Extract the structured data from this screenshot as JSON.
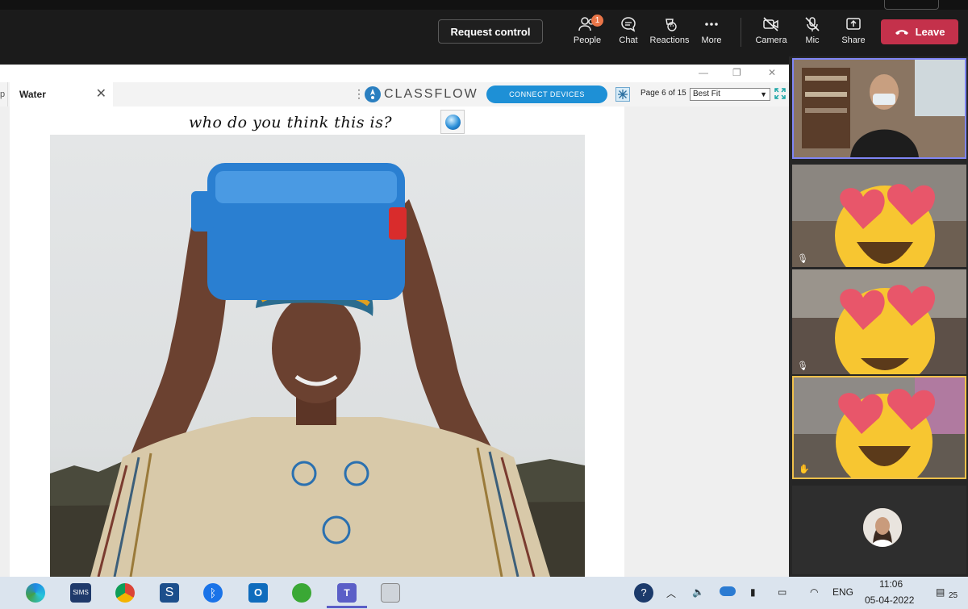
{
  "teams": {
    "request_control": "Request control",
    "people": {
      "label": "People",
      "badge": "1"
    },
    "chat": "Chat",
    "reactions": "Reactions",
    "more": "More",
    "camera": "Camera",
    "mic": "Mic",
    "share": "Share",
    "leave": "Leave",
    "colors": {
      "leave": "#c4314b",
      "badge": "#e97548",
      "active_border": "#7f85f5",
      "hand_border": "#f0c14b"
    }
  },
  "window": {
    "controls": [
      "—",
      "❐",
      "✕"
    ]
  },
  "browser": {
    "left_tab_fragment": "p",
    "tab": "Water",
    "tab_close": "✕",
    "menu": "⋮"
  },
  "classflow": {
    "brand": "CLASSFLOW",
    "connect": "CONNECT DEVICES",
    "page": "Page 6 of 15",
    "zoom": "Best Fit",
    "colors": {
      "connect": "#1e90d6"
    }
  },
  "slide": {
    "title": "who do you think this is?"
  },
  "taskbar": {
    "sims": "SIMS",
    "lang": "ENG",
    "time": "11:06",
    "date": "05-04-2022",
    "notif": "25"
  }
}
